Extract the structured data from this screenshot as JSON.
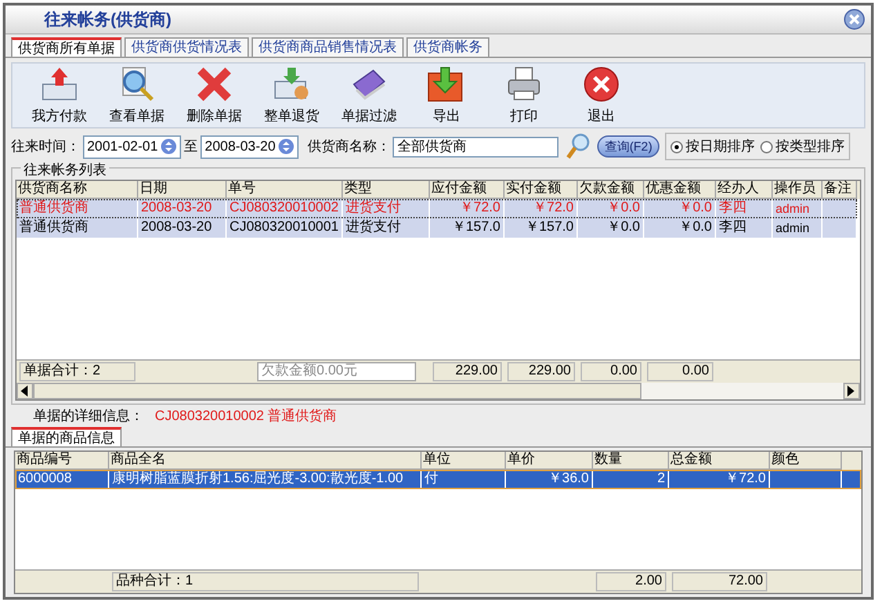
{
  "window": {
    "title": "往来帐务(供货商)"
  },
  "tabs": [
    {
      "label": "供货商所有单据",
      "selected": true
    },
    {
      "label": "供货商供货情况表",
      "selected": false
    },
    {
      "label": "供货商商品销售情况表",
      "selected": false
    },
    {
      "label": "供货商帐务",
      "selected": false
    }
  ],
  "toolbar": [
    "我方付款",
    "查看单据",
    "删除单据",
    "整单退货",
    "单据过滤",
    "导出",
    "打印",
    "退出"
  ],
  "filter": {
    "period_label": "往来时间：",
    "date_from": "2001-02-01",
    "to_label": "至",
    "date_to": "2008-03-20",
    "supplier_label": "供货商名称：",
    "supplier": "全部供货商",
    "query_button": "查询(F2)",
    "sort_options": [
      {
        "label": "按日期排序",
        "selected": true
      },
      {
        "label": "按类型排序",
        "selected": false
      }
    ]
  },
  "ledger": {
    "title": "往来帐务列表",
    "columns": [
      "供货商名称",
      "日期",
      "单号",
      "类型",
      "应付金额",
      "实付金额",
      "欠款金额",
      "优惠金额",
      "经办人",
      "操作员",
      "备注"
    ],
    "rows": [
      {
        "cells": [
          "普通供货商",
          "2008-03-20",
          "CJ080320010002",
          "进货支付",
          "￥72.0",
          "￥72.0",
          "￥0.0",
          "￥0.0",
          "李四",
          "admin"
        ],
        "selected": true
      },
      {
        "cells": [
          "普通供货商",
          "2008-03-20",
          "CJ080320010001",
          "进货支付",
          "￥157.0",
          "￥157.0",
          "￥0.0",
          "￥0.0",
          "李四",
          "admin"
        ],
        "selected": false
      }
    ],
    "summary": {
      "count": "单据合计：2",
      "debt_field": "欠款金额0.00元",
      "totals": [
        "229.00",
        "229.00",
        "0.00",
        "0.00"
      ]
    }
  },
  "detail": {
    "label": "单据的详细信息：",
    "value": "CJ080320010002 普通供货商"
  },
  "items_tab": {
    "label": "单据的商品信息",
    "selected": true
  },
  "items": {
    "columns": [
      "商品编号",
      "商品全名",
      "单位",
      "单价",
      "数量",
      "总金额",
      "颜色"
    ],
    "rows": [
      {
        "cells": [
          "6000008",
          "康明树脂蓝膜折射1.56:屈光度-3.00:散光度-1.00",
          "付",
          "￥36.0",
          "2",
          "￥72.0"
        ],
        "selected": true
      }
    ],
    "summary": {
      "variety": "品种合计：1",
      "quantity": "2.00",
      "total": "72.00"
    }
  }
}
